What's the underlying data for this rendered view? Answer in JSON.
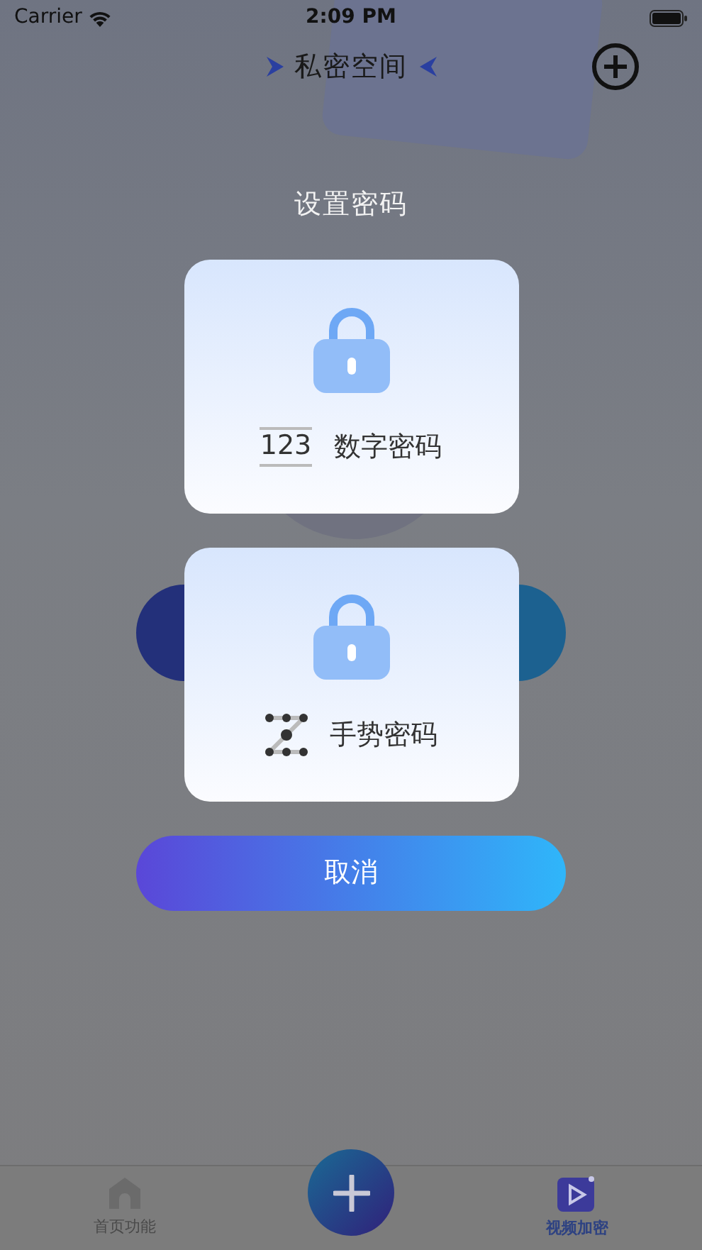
{
  "status_bar": {
    "carrier": "Carrier",
    "time": "2:09 PM"
  },
  "nav": {
    "title": "私密空间"
  },
  "dialog": {
    "title": "设置密码",
    "options": [
      {
        "kind": "digits",
        "icon_text": "123",
        "label": "数字密码"
      },
      {
        "kind": "gesture",
        "label": "手势密码"
      }
    ],
    "cancel": "取消"
  },
  "tab_bar": {
    "tabs": [
      {
        "kind": "home",
        "label": "首页功能",
        "selected": false
      },
      {
        "kind": "video",
        "label": "视频加密",
        "selected": true
      }
    ]
  }
}
